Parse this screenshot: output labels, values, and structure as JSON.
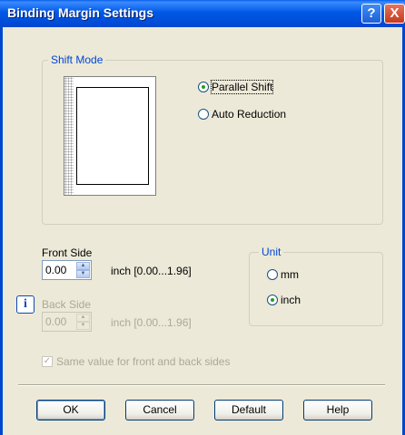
{
  "window": {
    "title": "Binding Margin Settings",
    "help_glyph": "?",
    "close_glyph": "X"
  },
  "shift_mode": {
    "legend": "Shift Mode",
    "options": [
      {
        "label": "Parallel Shift",
        "selected": true
      },
      {
        "label": "Auto Reduction",
        "selected": false
      }
    ]
  },
  "front_side": {
    "label": "Front Side",
    "value": "0.00",
    "range": "inch [0.00...1.96]"
  },
  "back_side": {
    "label": "Back Side",
    "value": "0.00",
    "range": "inch [0.00...1.96]",
    "enabled": false
  },
  "unit": {
    "legend": "Unit",
    "options": [
      {
        "label": "mm",
        "selected": false
      },
      {
        "label": "inch",
        "selected": true
      }
    ]
  },
  "same_value": {
    "label": "Same value for front and back sides",
    "checked": true,
    "enabled": false
  },
  "buttons": {
    "ok": "OK",
    "cancel": "Cancel",
    "default": "Default",
    "help": "Help"
  },
  "icons": {
    "info": "i",
    "check": "✓",
    "spin_up": "▲",
    "spin_down": "▼"
  },
  "colors": {
    "accent": "#0046D5",
    "radio_dot": "#21A121",
    "title_bar": "#0058E6"
  }
}
